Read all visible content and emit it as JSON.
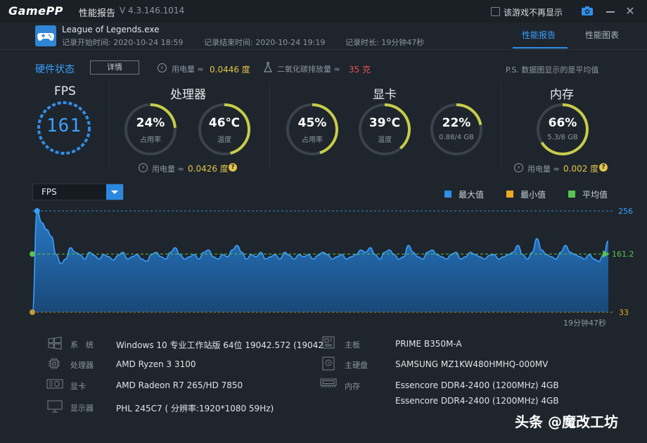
{
  "titlebar": {
    "logo": "GamePP",
    "title": "性能报告",
    "version": "V 4.3.146.1014",
    "no_show_label": "该游戏不再显示"
  },
  "header": {
    "game_name": "League of Legends.exe",
    "start": "记录开始时间: 2020-10-24 18:59",
    "end": "记录结束时间: 2020-10-24 19:19",
    "duration": "记录时长: 19分钟47秒",
    "tabs": [
      "性能报告",
      "性能图表"
    ]
  },
  "hardware": {
    "title": "硬件状态",
    "detail_button": "详情",
    "power_label": "用电量 ≈",
    "power_value": "0.0446 度",
    "co2_label": "二氧化碳排放量 ≈",
    "co2_value": "35 克",
    "note": "P.S. 数据图显示的是平均值"
  },
  "fps": {
    "title": "FPS",
    "value": "161"
  },
  "cpu": {
    "title": "处理器",
    "usage": {
      "value": "24%",
      "label": "占用率",
      "fraction": 0.24
    },
    "temp": {
      "value": "46℃",
      "label": "温度",
      "fraction": 0.46
    },
    "power_label": "用电量 ≈",
    "power_value": "0.0426 度"
  },
  "gpu": {
    "title": "显卡",
    "usage": {
      "value": "45%",
      "label": "占用率",
      "fraction": 0.45
    },
    "temp": {
      "value": "39℃",
      "label": "温度",
      "fraction": 0.39
    },
    "mem": {
      "value": "22%",
      "label": "0.88/4 GB",
      "fraction": 0.22
    }
  },
  "memory": {
    "title": "内存",
    "usage": {
      "value": "66%",
      "label": "5.3/8 GB",
      "fraction": 0.66
    },
    "power_label": "用电量 ≈",
    "power_value": "0.002 度"
  },
  "chart": {
    "select": "FPS",
    "legend": [
      {
        "label": "最大值",
        "color": "#2f8fe8"
      },
      {
        "label": "最小值",
        "color": "#e8a923"
      },
      {
        "label": "平均值",
        "color": "#58c34d"
      }
    ],
    "duration": "19分钟47秒"
  },
  "chart_data": {
    "type": "area",
    "ylim": [
      33,
      256
    ],
    "max_label": "256",
    "avg_label": "161.2",
    "min_label": "33",
    "max": 256,
    "avg": 161.2,
    "min": 33,
    "values": [
      33,
      256,
      230,
      215,
      200,
      160,
      140,
      150,
      175,
      165,
      160,
      150,
      165,
      158,
      150,
      160,
      155,
      148,
      158,
      165,
      150,
      155,
      160,
      150,
      145,
      160,
      165,
      155,
      150,
      165,
      175,
      160,
      150,
      155,
      160,
      150,
      165,
      170,
      155,
      150,
      160,
      155,
      170,
      180,
      165,
      150,
      160,
      155,
      165,
      150,
      155,
      160,
      150,
      165,
      158,
      150,
      160,
      155,
      160,
      150,
      158,
      165,
      160,
      150,
      155,
      160,
      150,
      155,
      160,
      170,
      165,
      175,
      160,
      150,
      165,
      170,
      160,
      150,
      155,
      180,
      165,
      155,
      150,
      165,
      170,
      160,
      155,
      150,
      160,
      165,
      150,
      155,
      165,
      160,
      155,
      150,
      158,
      160,
      150,
      155,
      160,
      165,
      180,
      160,
      150,
      165,
      195,
      170,
      160,
      155,
      150,
      165,
      180,
      165,
      160,
      155,
      150,
      160,
      150,
      145,
      160,
      190
    ]
  },
  "sysinfo": {
    "left": [
      {
        "label": "系　统",
        "value": "Windows 10 专业工作站版 64位   19042.572 (19042",
        "icon": "windows-icon"
      },
      {
        "label": "处理器",
        "value": "AMD Ryzen 3 3100",
        "icon": "cpu-icon"
      },
      {
        "label": "显卡",
        "value": "AMD Radeon R7 265/HD 7850",
        "icon": "gpu-icon"
      },
      {
        "label": "显示器",
        "value": "PHL 245C7 ( 分辨率:1920*1080 59Hz)",
        "icon": "monitor-icon"
      }
    ],
    "right": [
      {
        "label": "主板",
        "value": "PRIME B350M-A",
        "icon": "motherboard-icon"
      },
      {
        "label": "主硬盘",
        "value": "SAMSUNG MZ1KW480HMHQ-000MV",
        "icon": "disk-icon"
      },
      {
        "label": "内存",
        "value": "Essencore DDR4-2400 (1200MHz) 4GB",
        "icon": "ram-icon"
      },
      {
        "label": "",
        "value": "Essencore DDR4-2400 (1200MHz) 4GB",
        "icon": ""
      }
    ]
  },
  "watermark": "头条 @魔改工坊"
}
